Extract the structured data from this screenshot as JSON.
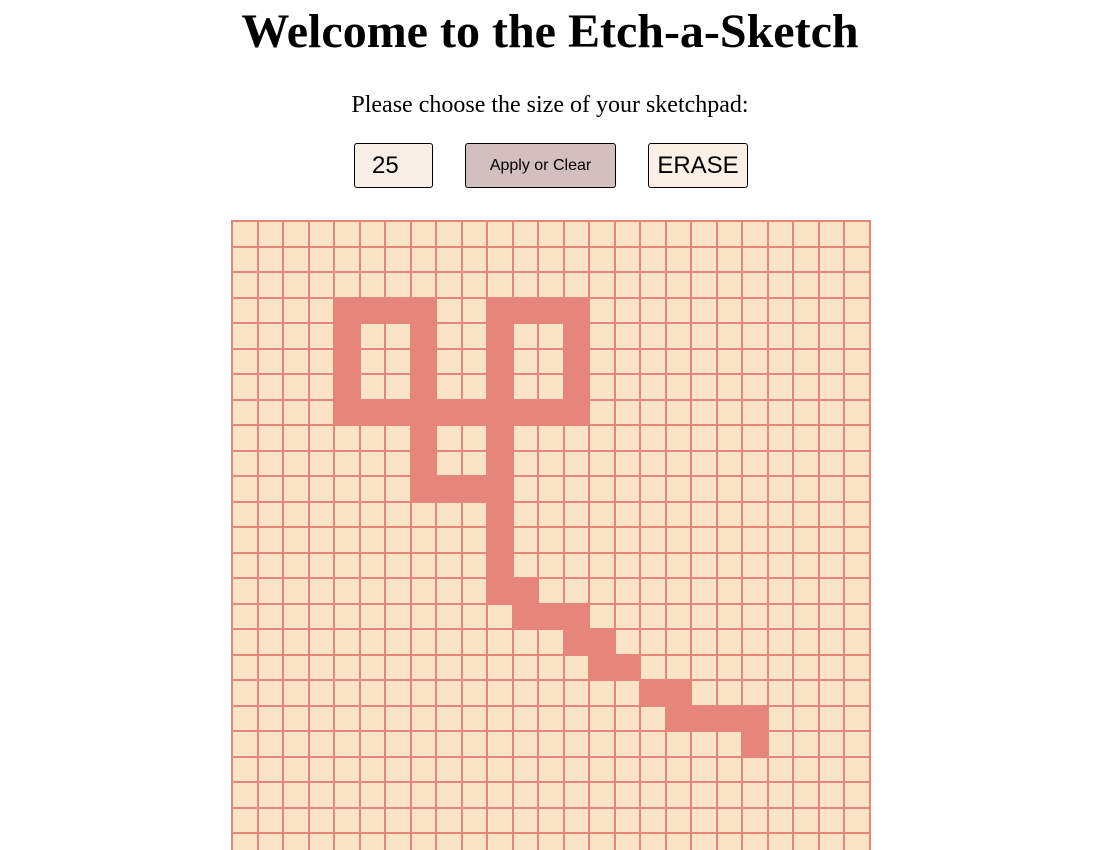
{
  "page": {
    "title": "Welcome to the Etch-a-Sketch",
    "prompt": "Please choose the size of your sketchpad:"
  },
  "controls": {
    "size_value": "25",
    "apply_label": "Apply or Clear",
    "erase_label": "ERASE"
  },
  "colors": {
    "cell_background": "#fbe3c6",
    "cell_border": "#e6857a",
    "cell_filled": "#e6857a",
    "apply_button": "#d4bfbf",
    "input_background": "#f7efe6"
  },
  "sketchpad": {
    "grid_size": 25,
    "filled_rows": [
      [],
      [],
      [],
      [
        4,
        5,
        6,
        7,
        10,
        11,
        12,
        13
      ],
      [
        4,
        7,
        10,
        13
      ],
      [
        4,
        7,
        10,
        13
      ],
      [
        4,
        7,
        10,
        13
      ],
      [
        4,
        5,
        6,
        7,
        8,
        9,
        10,
        11,
        12,
        13
      ],
      [
        7,
        10
      ],
      [
        7,
        10
      ],
      [
        7,
        8,
        9,
        10
      ],
      [
        10
      ],
      [
        10
      ],
      [
        10
      ],
      [
        10,
        11
      ],
      [
        11,
        12,
        13
      ],
      [
        13,
        14
      ],
      [
        14,
        15
      ],
      [
        16,
        17
      ],
      [
        17,
        18,
        19,
        20
      ],
      [
        20
      ],
      [],
      [],
      [],
      []
    ]
  }
}
